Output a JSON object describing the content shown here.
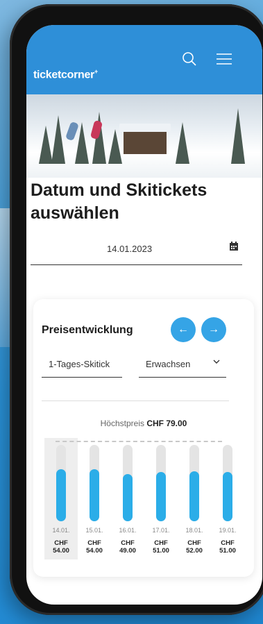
{
  "header": {
    "logo": "ticketcorner",
    "logo_mark": "+"
  },
  "page": {
    "title_line1": "Datum und Skitickets",
    "title_line2": "auswählen"
  },
  "date": {
    "value": "14.01.2023"
  },
  "card": {
    "title": "Preisentwicklung",
    "prev_label": "←",
    "next_label": "→",
    "ticket_select": "1-Tages-Skitick",
    "age_select": "Erwachsen",
    "max_label": "Höchstpreis",
    "max_value": "CHF 79.00"
  },
  "chart_data": {
    "type": "bar",
    "categories": [
      "14.01.",
      "15.01.",
      "16.01.",
      "17.01.",
      "18.01.",
      "19.01."
    ],
    "values": [
      54.0,
      54.0,
      49.0,
      51.0,
      52.0,
      51.0
    ],
    "price_labels": [
      {
        "currency": "CHF",
        "amount": "54.00"
      },
      {
        "currency": "CHF",
        "amount": "54.00"
      },
      {
        "currency": "CHF",
        "amount": "49.00"
      },
      {
        "currency": "CHF",
        "amount": "51.00"
      },
      {
        "currency": "CHF",
        "amount": "52.00"
      },
      {
        "currency": "CHF",
        "amount": "51.00"
      }
    ],
    "ylim": [
      0,
      79
    ],
    "selected_index": 0,
    "colors": {
      "bar": "#2bade8",
      "track": "#e4e4e4"
    }
  }
}
